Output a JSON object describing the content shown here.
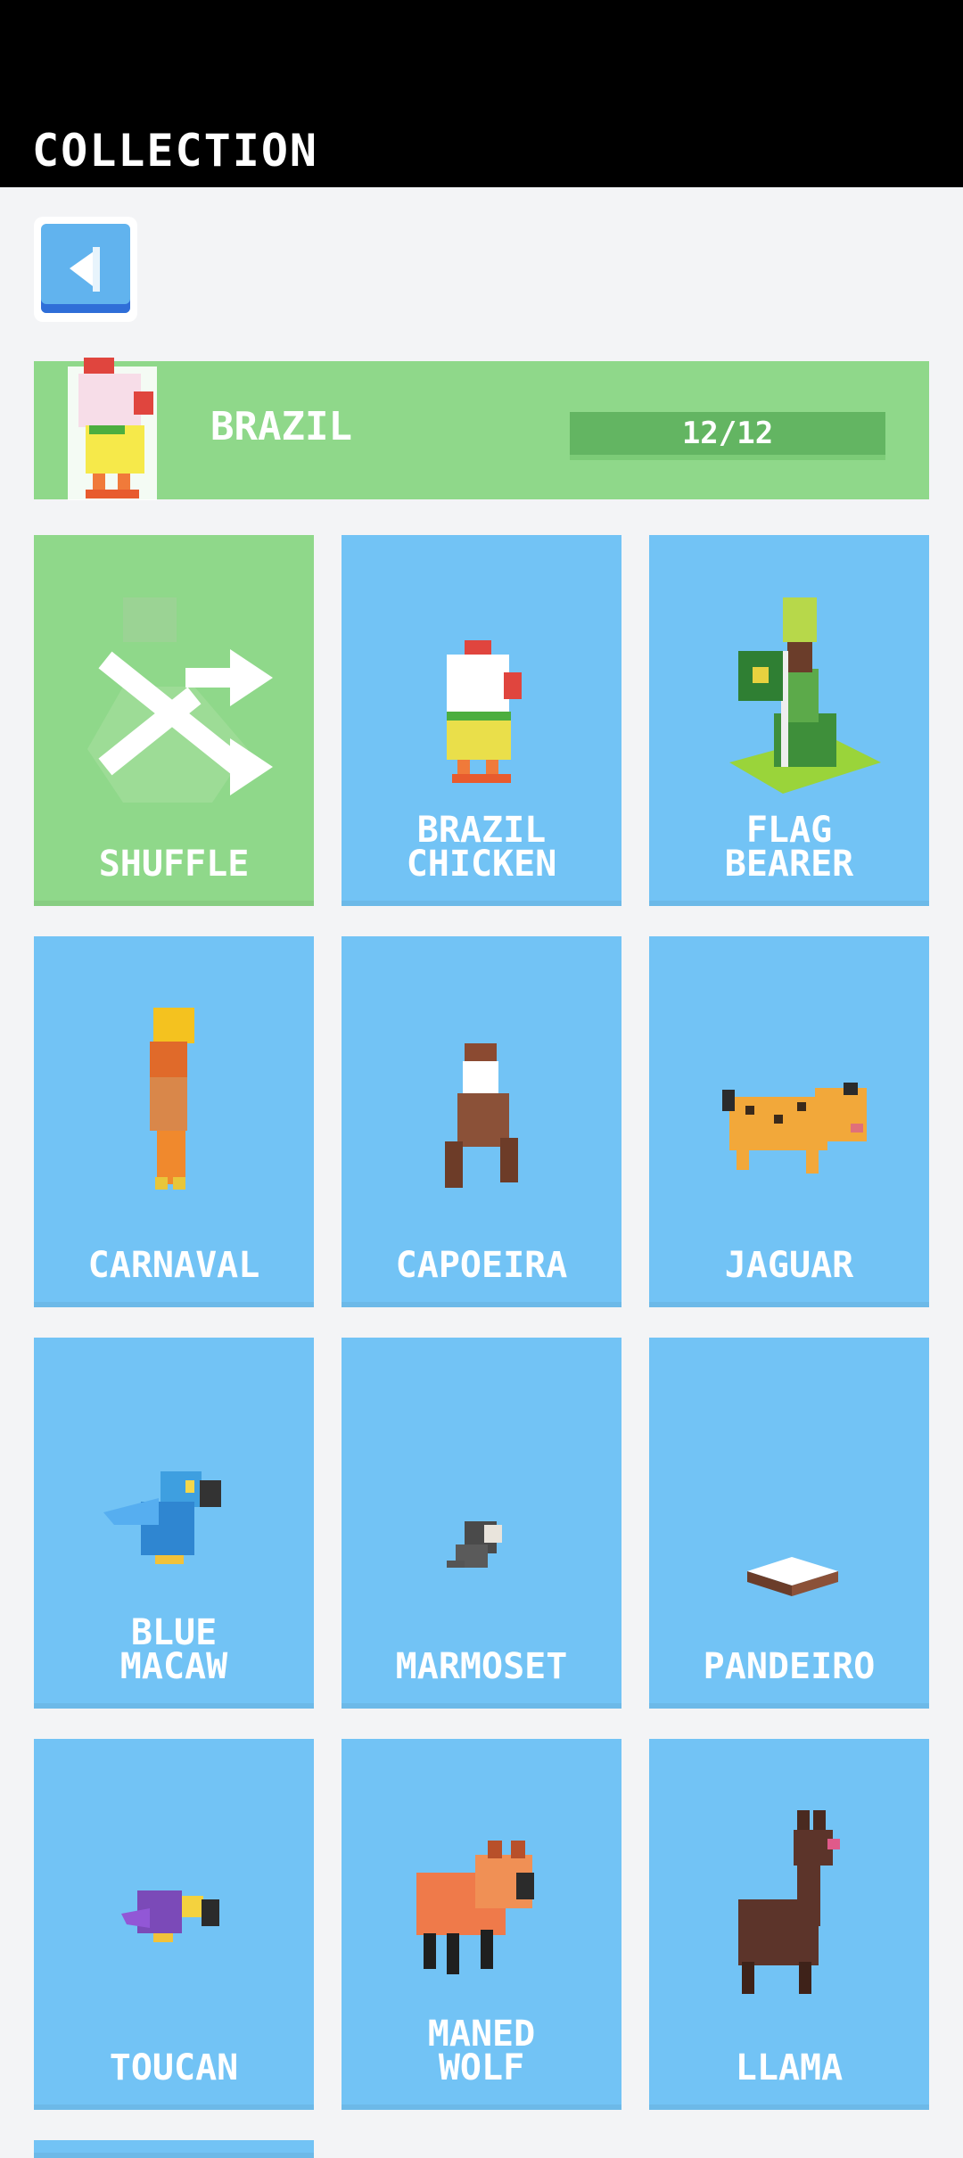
{
  "header": {
    "title": "COLLECTION"
  },
  "back": {
    "icon": "back-arrow-icon"
  },
  "banner": {
    "country": "BRAZIL",
    "progress_text": "12/12",
    "progress_fraction": 1.0
  },
  "cards": [
    {
      "label": "SHUFFLE",
      "kind": "shuffle"
    },
    {
      "label": "BRAZIL\nCHICKEN",
      "kind": "chicken"
    },
    {
      "label": "FLAG\nBEARER",
      "kind": "flag"
    },
    {
      "label": "CARNAVAL",
      "kind": "carnaval"
    },
    {
      "label": "CAPOEIRA",
      "kind": "capoeira"
    },
    {
      "label": "JAGUAR",
      "kind": "jaguar"
    },
    {
      "label": "BLUE\nMACAW",
      "kind": "macaw"
    },
    {
      "label": "MARMOSET",
      "kind": "marmoset"
    },
    {
      "label": "PANDEIRO",
      "kind": "pandeiro"
    },
    {
      "label": "TOUCAN",
      "kind": "toucan"
    },
    {
      "label": "MANED\nWOLF",
      "kind": "wolf"
    },
    {
      "label": "LLAMA",
      "kind": "llama"
    }
  ],
  "colors": {
    "card_blue": "#72c3f5",
    "card_green": "#8fd88a",
    "progress": "#63b562"
  }
}
